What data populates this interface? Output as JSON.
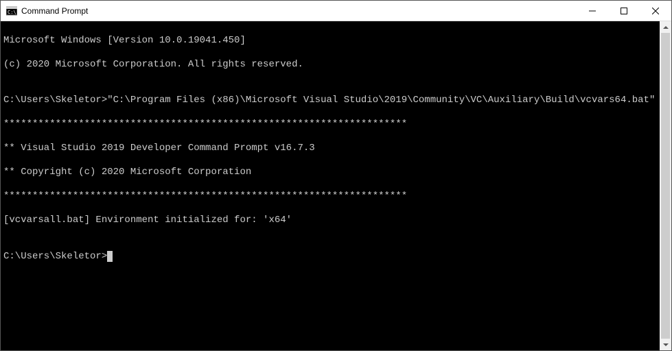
{
  "window": {
    "title": "Command Prompt"
  },
  "terminal": {
    "line1": "Microsoft Windows [Version 10.0.19041.450]",
    "line2": "(c) 2020 Microsoft Corporation. All rights reserved.",
    "blank1": "",
    "prompt1_path": "C:\\Users\\Skeletor>",
    "prompt1_cmd": "\"C:\\Program Files (x86)\\Microsoft Visual Studio\\2019\\Community\\VC\\Auxiliary\\Build\\vcvars64.bat\"",
    "stars1": "**********************************************************************",
    "vs_line1": "** Visual Studio 2019 Developer Command Prompt v16.7.3",
    "vs_line2": "** Copyright (c) 2020 Microsoft Corporation",
    "stars2": "**********************************************************************",
    "env_line": "[vcvarsall.bat] Environment initialized for: 'x64'",
    "blank2": "",
    "prompt2_path": "C:\\Users\\Skeletor>"
  }
}
